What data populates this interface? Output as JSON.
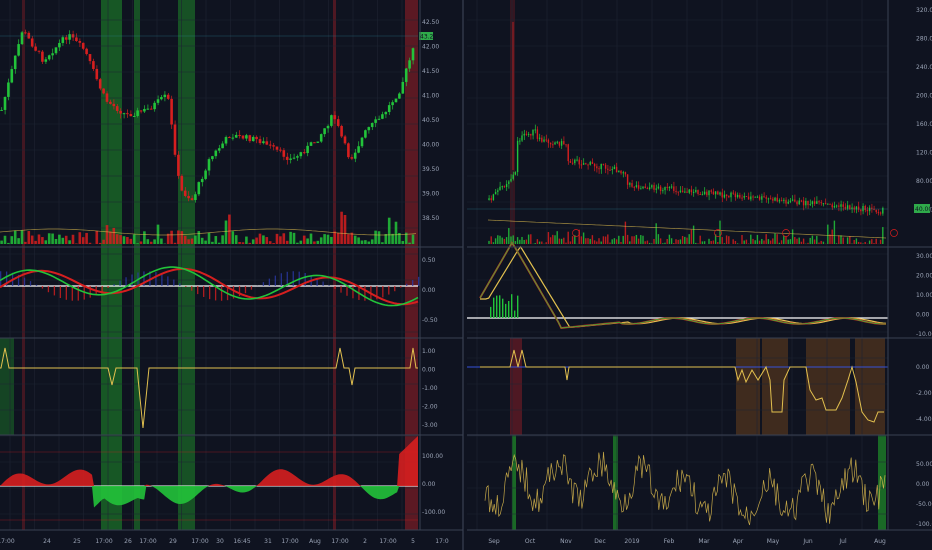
{
  "colors": {
    "background": "#0f1320",
    "pane_border": "#3a4152",
    "grid": "#1e2433",
    "up": "#22c33a",
    "down": "#d61f1f",
    "signal": "#e2c04f",
    "highlight_green": "#1f8f2a",
    "highlight_red": "#8e1e26",
    "highlight_orange": "#7a4a1c",
    "zero_line": "#ffffff",
    "price_tag": "#2faa4a"
  },
  "left_chart": {
    "price_axis": [
      "42.50",
      "42.00",
      "41.50",
      "41.00",
      "40.50",
      "40.00",
      "39.50",
      "39.00",
      "38.50"
    ],
    "price_tag": "43.25",
    "macd_axis": [
      "0.50",
      "0.00",
      "-0.50"
    ],
    "signal_axis": [
      "1.00",
      "0.00",
      "-1.00",
      "-2.00",
      "-3.00"
    ],
    "osc_axis": [
      "100.00",
      "0.00",
      "-100.00"
    ],
    "x_labels": [
      "17:00",
      "24",
      "25",
      "17:00",
      "26",
      "17:00",
      "29",
      "17:00",
      "30",
      "16:45",
      "31",
      "17:00",
      "Aug",
      "17:00",
      "2",
      "17:00",
      "5",
      "17:0"
    ]
  },
  "right_chart": {
    "price_axis": [
      "320.00",
      "280.00",
      "240.00",
      "200.00",
      "160.00",
      "120.00",
      "80.00",
      "40.00"
    ],
    "price_tag": "40.00",
    "macd_axis": [
      "30.00",
      "20.00",
      "10.00",
      "0.00",
      "-10.00"
    ],
    "signal_axis": [
      "0.00",
      "-2.00",
      "-4.00"
    ],
    "osc_axis": [
      "50.00",
      "0.00",
      "-50.00",
      "-100.00"
    ],
    "x_labels": [
      "Sep",
      "Oct",
      "Nov",
      "Dec",
      "2019",
      "Feb",
      "Mar",
      "Apr",
      "May",
      "Jun",
      "Jul",
      "Aug"
    ]
  }
}
